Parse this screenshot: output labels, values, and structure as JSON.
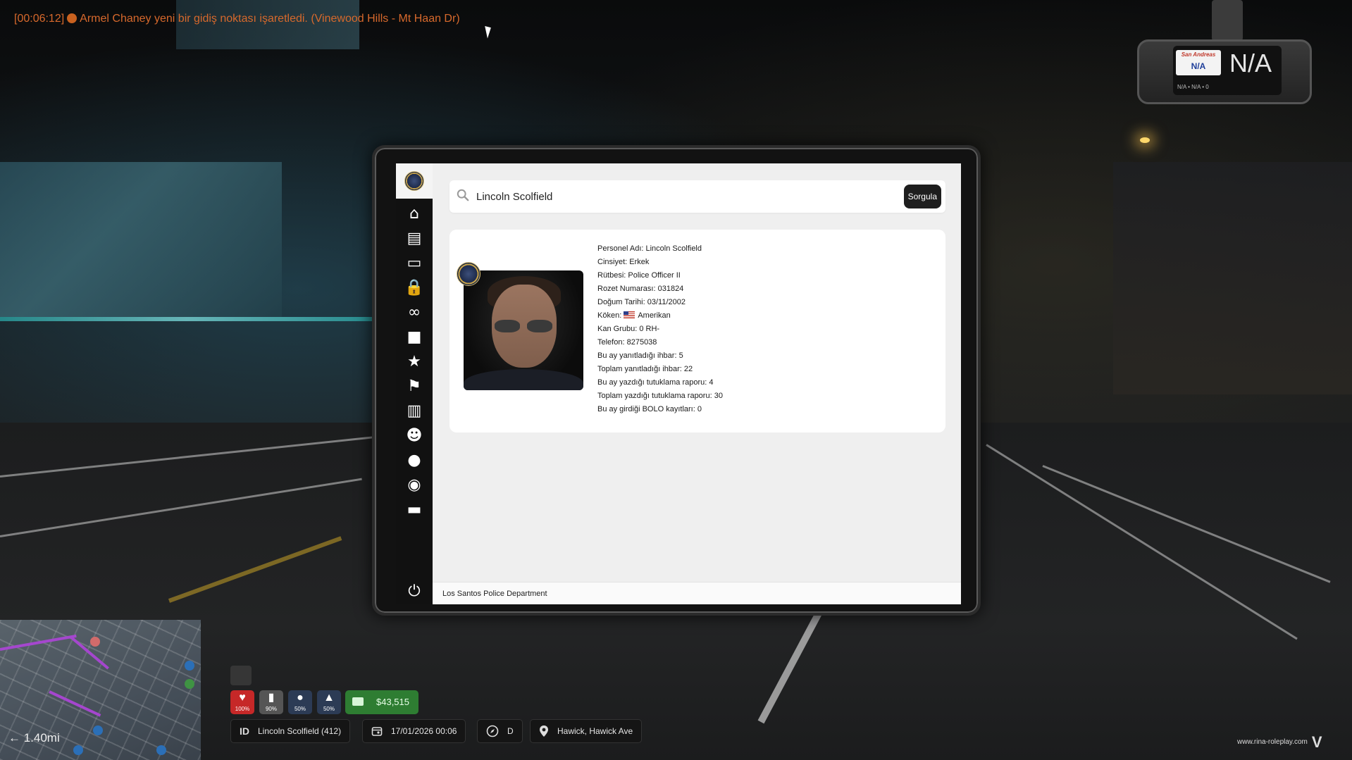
{
  "notification": {
    "time": "[00:06:12]",
    "message": "Armel Chaney yeni bir gidiş noktası işaretledi. (Vinewood Hills - Mt Haan Dr)"
  },
  "dashcam": {
    "plate_state": "San Andreas",
    "plate_small": "N/A",
    "plate_large": "N/A",
    "plate_sub": "N/A • N/A • 0"
  },
  "mdt": {
    "search": {
      "value": "Lincoln Scolfield",
      "button_label": "Sorgula"
    },
    "sidebar": [
      {
        "name": "home-icon",
        "glyph": "⌂"
      },
      {
        "name": "notes-icon",
        "glyph": "▤"
      },
      {
        "name": "folder-icon",
        "glyph": "▭"
      },
      {
        "name": "lock-icon",
        "glyph": "🔒"
      },
      {
        "name": "binoculars-icon",
        "glyph": "∞"
      },
      {
        "name": "briefcase-icon",
        "glyph": "■"
      },
      {
        "name": "star-icon",
        "glyph": "★"
      },
      {
        "name": "flag-icon",
        "glyph": "⚑"
      },
      {
        "name": "clipboard-icon",
        "glyph": "▥"
      },
      {
        "name": "users-icon",
        "glyph": "☻"
      },
      {
        "name": "user-icon",
        "glyph": "●"
      },
      {
        "name": "gauge-icon",
        "glyph": "◉"
      },
      {
        "name": "archive-icon",
        "glyph": "▬"
      }
    ],
    "power_glyph": "⏻",
    "profile": {
      "rows": [
        {
          "label": "Personel Adı:",
          "value": "Lincoln Scolfield"
        },
        {
          "label": "Cinsiyet:",
          "value": "Erkek"
        },
        {
          "label": "Rütbesi:",
          "value": "Police Officer II"
        },
        {
          "label": "Rozet Numarası:",
          "value": "031824"
        },
        {
          "label": "Doğum Tarihi:",
          "value": "03/11/2002"
        },
        {
          "label": "Köken:",
          "value": "Amerikan"
        },
        {
          "label": "Kan Grubu:",
          "value": "0 RH-"
        },
        {
          "label": "Telefon:",
          "value": "8275038"
        },
        {
          "label": "Bu ay yanıtladığı ihbar:",
          "value": "5"
        },
        {
          "label": "Toplam yanıtladığı ihbar:",
          "value": "22"
        },
        {
          "label": "Bu ay yazdığı tutuklama raporu:",
          "value": "4"
        },
        {
          "label": "Toplam yazdığı tutuklama raporu:",
          "value": "30"
        },
        {
          "label": "Bu ay girdiği BOLO kayıtları:",
          "value": "0"
        }
      ]
    },
    "footer": "Los Santos Police Department"
  },
  "hud": {
    "distance": "← 1.40mi",
    "stats": [
      {
        "name": "health",
        "value": "100%",
        "color": "#c62828",
        "glyph": "♥"
      },
      {
        "name": "armor",
        "value": "90%",
        "color": "#555555",
        "glyph": "▮"
      },
      {
        "name": "hunger",
        "value": "50%",
        "color": "#2c3b55",
        "glyph": "●"
      },
      {
        "name": "thirst",
        "value": "50%",
        "color": "#2c3b55",
        "glyph": "▲"
      }
    ],
    "money": "$43,515",
    "id_label": "ID",
    "player": "Lincoln Scolfield (412)",
    "datetime": "17/01/2026 00:06",
    "direction": "D",
    "location": "Hawick, Hawick Ave",
    "website": "www.rina-roleplay.com",
    "website_mark": "V"
  }
}
